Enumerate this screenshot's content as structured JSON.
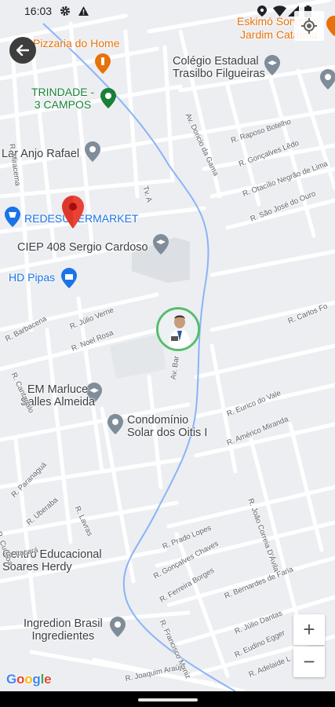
{
  "status_bar": {
    "time": "16:03"
  },
  "map": {
    "labels": [
      {
        "id": "eskimo-sorvetes",
        "text": "Eskimó Sorvetes",
        "cls": "orange"
      },
      {
        "id": "jardim-catarina",
        "text": "Jardim Catarina",
        "cls": "orange"
      },
      {
        "id": "pizzaria-do-home",
        "text": "Pizzaria do Home",
        "cls": "orange"
      },
      {
        "id": "colegio-estadual",
        "text": "Colégio Estadual\nTrasilbo Filgueiras",
        "cls": "poi2"
      },
      {
        "id": "trindade-3-campos",
        "text": "TRINDADE -\n3 CAMPOS",
        "cls": "green"
      },
      {
        "id": "lar-anjo-rafael",
        "text": "Lar Anjo Rafael",
        "cls": "poi2"
      },
      {
        "id": "redesupermarket",
        "text": "REDESUPERMARKET",
        "cls": "blue"
      },
      {
        "id": "ciep-408",
        "text": "CIEP 408 Sergio Cardoso",
        "cls": "poi2"
      },
      {
        "id": "hd-pipas",
        "text": "HD Pipas",
        "cls": "blue"
      },
      {
        "id": "em-marluce",
        "text": "EM Marluce\nSalles Almeida",
        "cls": "poi2"
      },
      {
        "id": "condominio-solar",
        "text": "Condomínio\nSolar dos Oitis I",
        "cls": "poi2"
      },
      {
        "id": "centro-educacional",
        "text": "Centro Educacional\nSoares Herdy",
        "cls": "poi2"
      },
      {
        "id": "ingredion-brasil",
        "text": "Ingredion Brasil\nIngredientes",
        "cls": "poi2"
      }
    ],
    "streets": [
      {
        "id": "r-miracema",
        "text": "R. Miracema"
      },
      {
        "id": "av-doricio-da-gama",
        "text": "Av. Doricio da Gama"
      },
      {
        "id": "r-raposo-botelho",
        "text": "R. Raposo Botelho"
      },
      {
        "id": "r-goncalves-ledo",
        "text": "R. Gonçalves Lêdo"
      },
      {
        "id": "r-otacilio-negrao",
        "text": "R. Otacílio Negrão de Lima"
      },
      {
        "id": "r-sao-jose-do-ouro",
        "text": "R. São José do Ouro"
      },
      {
        "id": "tv-a",
        "text": "Tv. A"
      },
      {
        "id": "r-carlos-fo",
        "text": "R. Carlos Fo"
      },
      {
        "id": "r-barbacena",
        "text": "R. Barbacena"
      },
      {
        "id": "r-julio-verne",
        "text": "R. Júlio Verne"
      },
      {
        "id": "r-noel-rosa",
        "text": "R. Noel Rosa"
      },
      {
        "id": "r-cantagalo",
        "text": "R. Cantagalo"
      },
      {
        "id": "av-bar",
        "text": "Av. Bar"
      },
      {
        "id": "r-eurico-do-vale",
        "text": "R. Eurico do Vale"
      },
      {
        "id": "r-americo-miranda",
        "text": "R. Américo Miranda"
      },
      {
        "id": "r-joao-correia",
        "text": "R. João Correia D'Ávila"
      },
      {
        "id": "r-paranagua",
        "text": "R. Paranaguá"
      },
      {
        "id": "r-uberaba",
        "text": "R. Uberaba"
      },
      {
        "id": "r-lavras",
        "text": "R. Lavras"
      },
      {
        "id": "r-curitiba",
        "text": "R. Curitiba"
      },
      {
        "id": "r-itacara",
        "text": "R. Itacará"
      },
      {
        "id": "r-prado-lopes",
        "text": "R. Prado Lopes"
      },
      {
        "id": "r-goncalves-chaves",
        "text": "R. Gonçalves Chaves"
      },
      {
        "id": "r-ferreira-borges",
        "text": "R. Ferreira Borges"
      },
      {
        "id": "r-bernardes-de-faria",
        "text": "R. Bernardes de Faria"
      },
      {
        "id": "r-francisco-muniz",
        "text": "R. Francisco Muniz"
      },
      {
        "id": "r-julio-dantas",
        "text": "R. Júlio Dantas"
      },
      {
        "id": "r-eudino-egger",
        "text": "R. Eudino Egger"
      },
      {
        "id": "r-adelaide-l",
        "text": "R. Adelaide L"
      },
      {
        "id": "r-joaquim-araujo",
        "text": "R. Joaquim Araújo"
      }
    ]
  },
  "controls": {
    "zoom_in_label": "+",
    "zoom_out_label": "−"
  },
  "attribution": {
    "logo_text": "Google"
  },
  "colors": {
    "river": "#8ab4f8",
    "marker_red": "#ea4335",
    "avatar_ring": "#55bd6e",
    "poi_green": "#188038",
    "poi_blue": "#1a73e8",
    "poi_orange": "#e8710a",
    "poi_gray": "#7f8c99"
  },
  "icons": {
    "back": "arrow-left-icon",
    "locate": "my-location-icon",
    "marker": "red-map-marker-icon"
  }
}
